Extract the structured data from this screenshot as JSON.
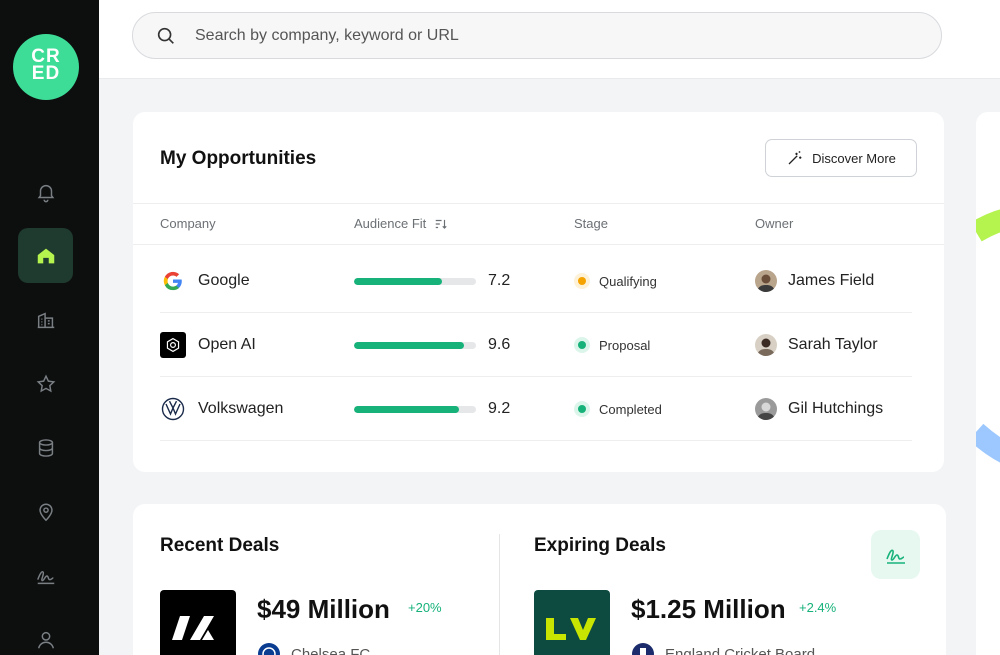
{
  "logo": {
    "line1": "CR",
    "line2": "ED"
  },
  "sidebar": {
    "items": [
      {
        "icon": "bell-icon",
        "active": false
      },
      {
        "icon": "home-icon",
        "active": true
      },
      {
        "icon": "building-icon",
        "active": false
      },
      {
        "icon": "star-icon",
        "active": false
      },
      {
        "icon": "database-icon",
        "active": false
      },
      {
        "icon": "location-pin-icon",
        "active": false
      },
      {
        "icon": "signature-icon",
        "active": false
      },
      {
        "icon": "user-icon",
        "active": false
      }
    ]
  },
  "search": {
    "placeholder": "Search by company, keyword or URL"
  },
  "opportunities": {
    "title": "My Opportunities",
    "discover_label": "Discover More",
    "columns": {
      "company": "Company",
      "audience_fit": "Audience Fit",
      "stage": "Stage",
      "owner": "Owner"
    },
    "rows": [
      {
        "company": "Google",
        "fit": "7.2",
        "fit_fraction": 0.72,
        "stage": "Qualifying",
        "stage_color": "#f5a300",
        "owner": "James Field"
      },
      {
        "company": "Open AI",
        "fit": "9.6",
        "fit_fraction": 0.9,
        "stage": "Proposal",
        "stage_color": "#16b27a",
        "owner": "Sarah Taylor"
      },
      {
        "company": "Volkswagen",
        "fit": "9.2",
        "fit_fraction": 0.86,
        "stage": "Completed",
        "stage_color": "#16b27a",
        "owner": "Gil Hutchings"
      }
    ]
  },
  "recent_deals": {
    "title": "Recent Deals",
    "amount": "$49 Million",
    "change": "+20%",
    "club": "Chelsea FC"
  },
  "expiring_deals": {
    "title": "Expiring Deals",
    "amount": "$1.25 Million",
    "change": "+2.4%",
    "club": "England Cricket Board"
  },
  "colors": {
    "accent": "#3ddc97",
    "positive": "#16b27a",
    "sidebar": "#0d0f0f"
  }
}
